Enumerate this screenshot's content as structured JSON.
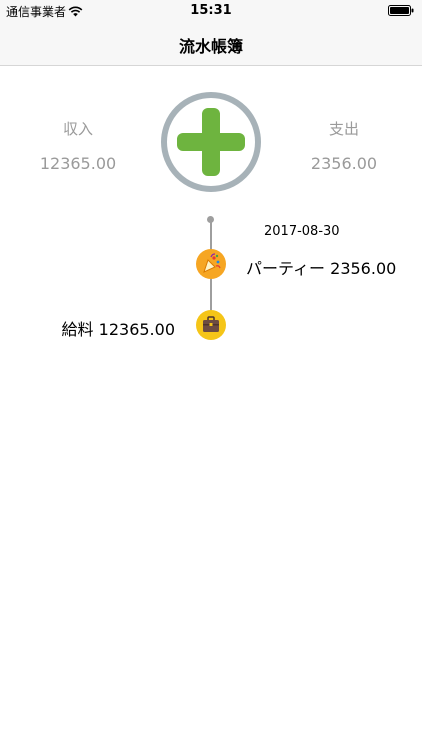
{
  "status_bar": {
    "carrier": "通信事業者",
    "time": "15:31"
  },
  "nav": {
    "title": "流水帳簿"
  },
  "summary": {
    "income_label": "収入",
    "income_value": "12365.00",
    "expense_label": "支出",
    "expense_value": "2356.00",
    "add_icon": "plus-circle-icon",
    "accent_color": "#6eb43f"
  },
  "timeline": {
    "date": "2017-08-30",
    "entries": [
      {
        "side": "right",
        "icon": "party-popper-icon",
        "name": "パーティー",
        "amount": "2356.00"
      },
      {
        "side": "left",
        "icon": "briefcase-icon",
        "name": "給料",
        "amount": "12365.00"
      }
    ]
  }
}
